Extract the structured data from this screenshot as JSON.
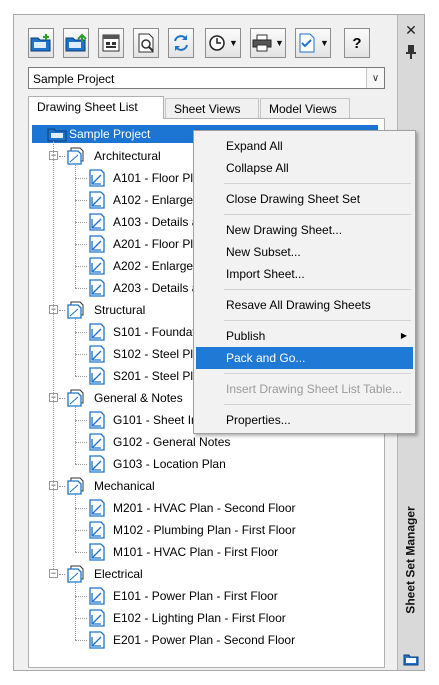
{
  "panel": {
    "title": "Sheet Set Manager",
    "close_glyph": "✕",
    "pin_glyph": "⊥",
    "colors": {
      "selection": "#1f7ad6",
      "window_bg": "#f0f0f0",
      "strip_bg": "#d9d9d9"
    }
  },
  "toolbar": {
    "buttons": [
      {
        "name": "new-sheet-set-icon"
      },
      {
        "name": "open-sheet-set-icon"
      },
      {
        "name": "model-view-icon"
      },
      {
        "name": "preview-icon"
      },
      {
        "name": "refresh-icon"
      },
      {
        "name": "history-icon",
        "dropdown": true
      },
      {
        "name": "publish-printer-icon",
        "dropdown": true
      },
      {
        "name": "check-layers-icon",
        "dropdown": true
      },
      {
        "name": "help-icon",
        "glyph": "?"
      }
    ]
  },
  "project_select": {
    "value": "Sample Project"
  },
  "tabs": [
    {
      "label": "Drawing Sheet List",
      "active": true
    },
    {
      "label": "Sheet Views",
      "active": false
    },
    {
      "label": "Model Views",
      "active": false
    }
  ],
  "tree": {
    "root": "Sample Project",
    "groups": [
      {
        "name": "Architectural",
        "sheets": [
          "A101 - Floor Plan",
          "A102 - Enlarged Fl",
          "A103 - Details and",
          "A201 - Floor Plan",
          "A202 - Enlarged Fl",
          "A203 - Details and"
        ]
      },
      {
        "name": "Structural",
        "sheets": [
          "S101 - Foundation",
          "S102 - Steel Plan -",
          "S201 - Steel Plan -"
        ]
      },
      {
        "name": "General & Notes",
        "sheets": [
          "G101 - Sheet Index",
          "G102 - General Notes",
          "G103 - Location Plan"
        ]
      },
      {
        "name": "Mechanical",
        "sheets": [
          "M201 - HVAC Plan - Second Floor",
          "M102 - Plumbing Plan - First Floor",
          "M101 - HVAC Plan - First Floor"
        ]
      },
      {
        "name": "Electrical",
        "sheets": [
          "E101 - Power Plan - First Floor",
          "E102 - Lighting Plan - First Floor",
          "E201 - Power Plan - Second Floor"
        ]
      }
    ]
  },
  "context_menu": {
    "items": [
      {
        "label": "Expand All"
      },
      {
        "label": "Collapse All"
      },
      {
        "sep": true
      },
      {
        "label": "Close Drawing Sheet Set"
      },
      {
        "sep": true
      },
      {
        "label": "New Drawing Sheet..."
      },
      {
        "label": "New Subset..."
      },
      {
        "label": "Import Sheet..."
      },
      {
        "sep": true
      },
      {
        "label": "Resave All Drawing Sheets"
      },
      {
        "sep": true
      },
      {
        "label": "Publish",
        "submenu": true
      },
      {
        "label": "Pack and Go...",
        "highlighted": true
      },
      {
        "sep": true
      },
      {
        "label": "Insert Drawing Sheet List Table...",
        "disabled": true
      },
      {
        "sep": true
      },
      {
        "label": "Properties..."
      }
    ]
  }
}
